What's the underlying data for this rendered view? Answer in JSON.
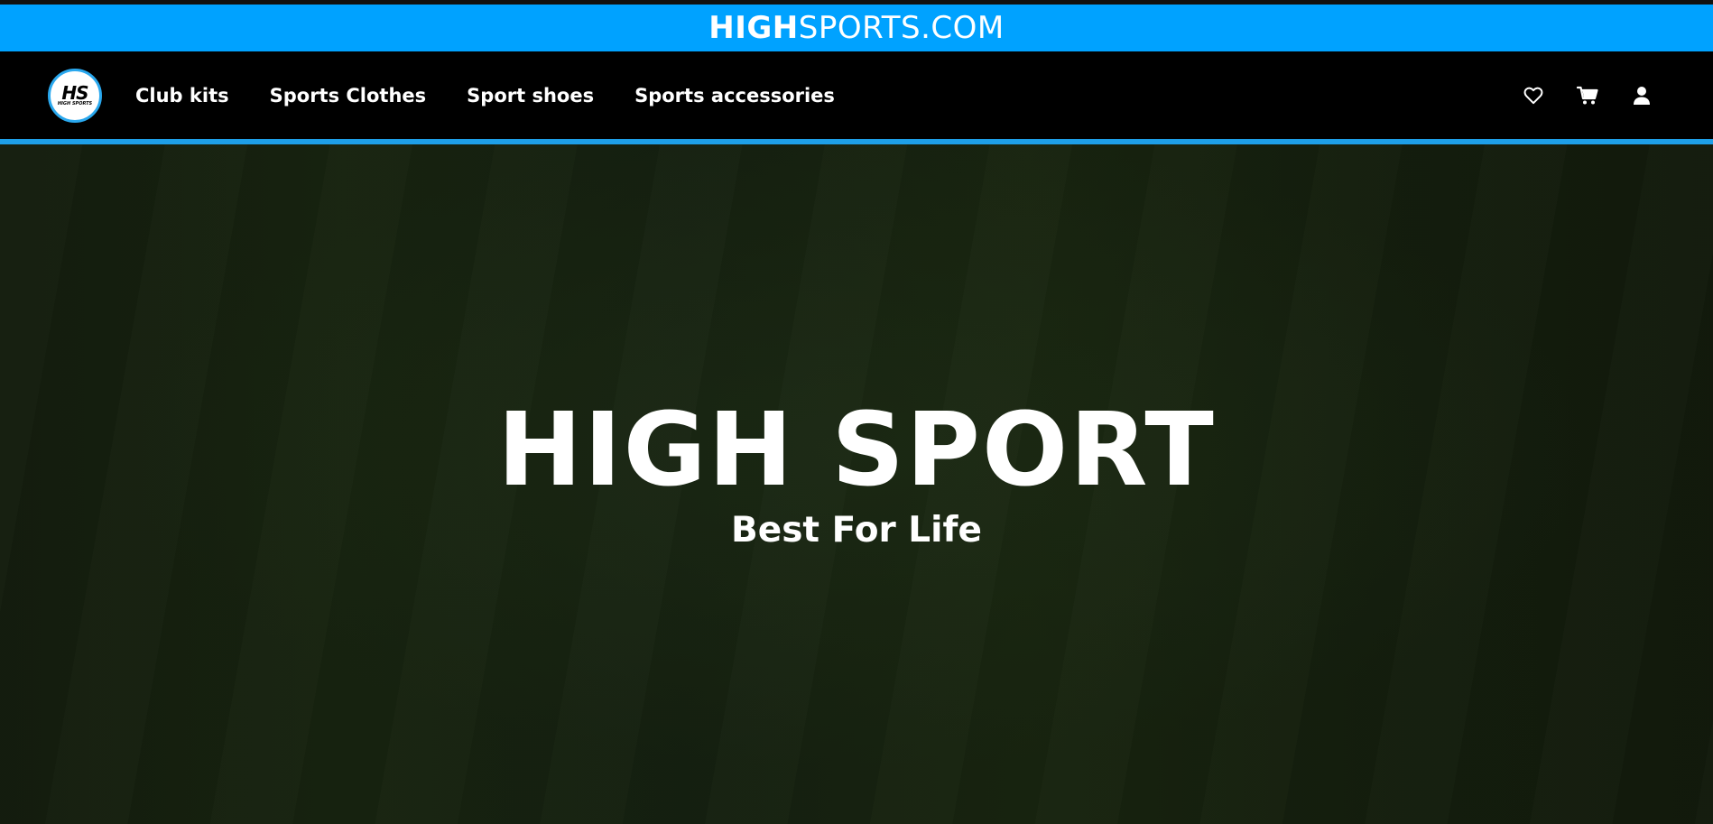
{
  "promo_bar": {
    "bold_text": "HIGH",
    "normal_text": "SPORTS.COM"
  },
  "logo": {
    "initials": "HS",
    "subtext": "HIGH SPORTS"
  },
  "nav": {
    "links": [
      {
        "label": "Club kits"
      },
      {
        "label": "Sports Clothes"
      },
      {
        "label": "Sport shoes"
      },
      {
        "label": "Sports accessories"
      }
    ],
    "icons": [
      "heart-icon",
      "cart-icon",
      "user-icon"
    ]
  },
  "hero": {
    "title": "HIGH SPORT",
    "subtitle": "Best For Life"
  },
  "colors": {
    "accent": "#00a2ff",
    "navbar": "#000000",
    "nav_border": "#1e9fe8",
    "hero_bg": "#16200f"
  }
}
